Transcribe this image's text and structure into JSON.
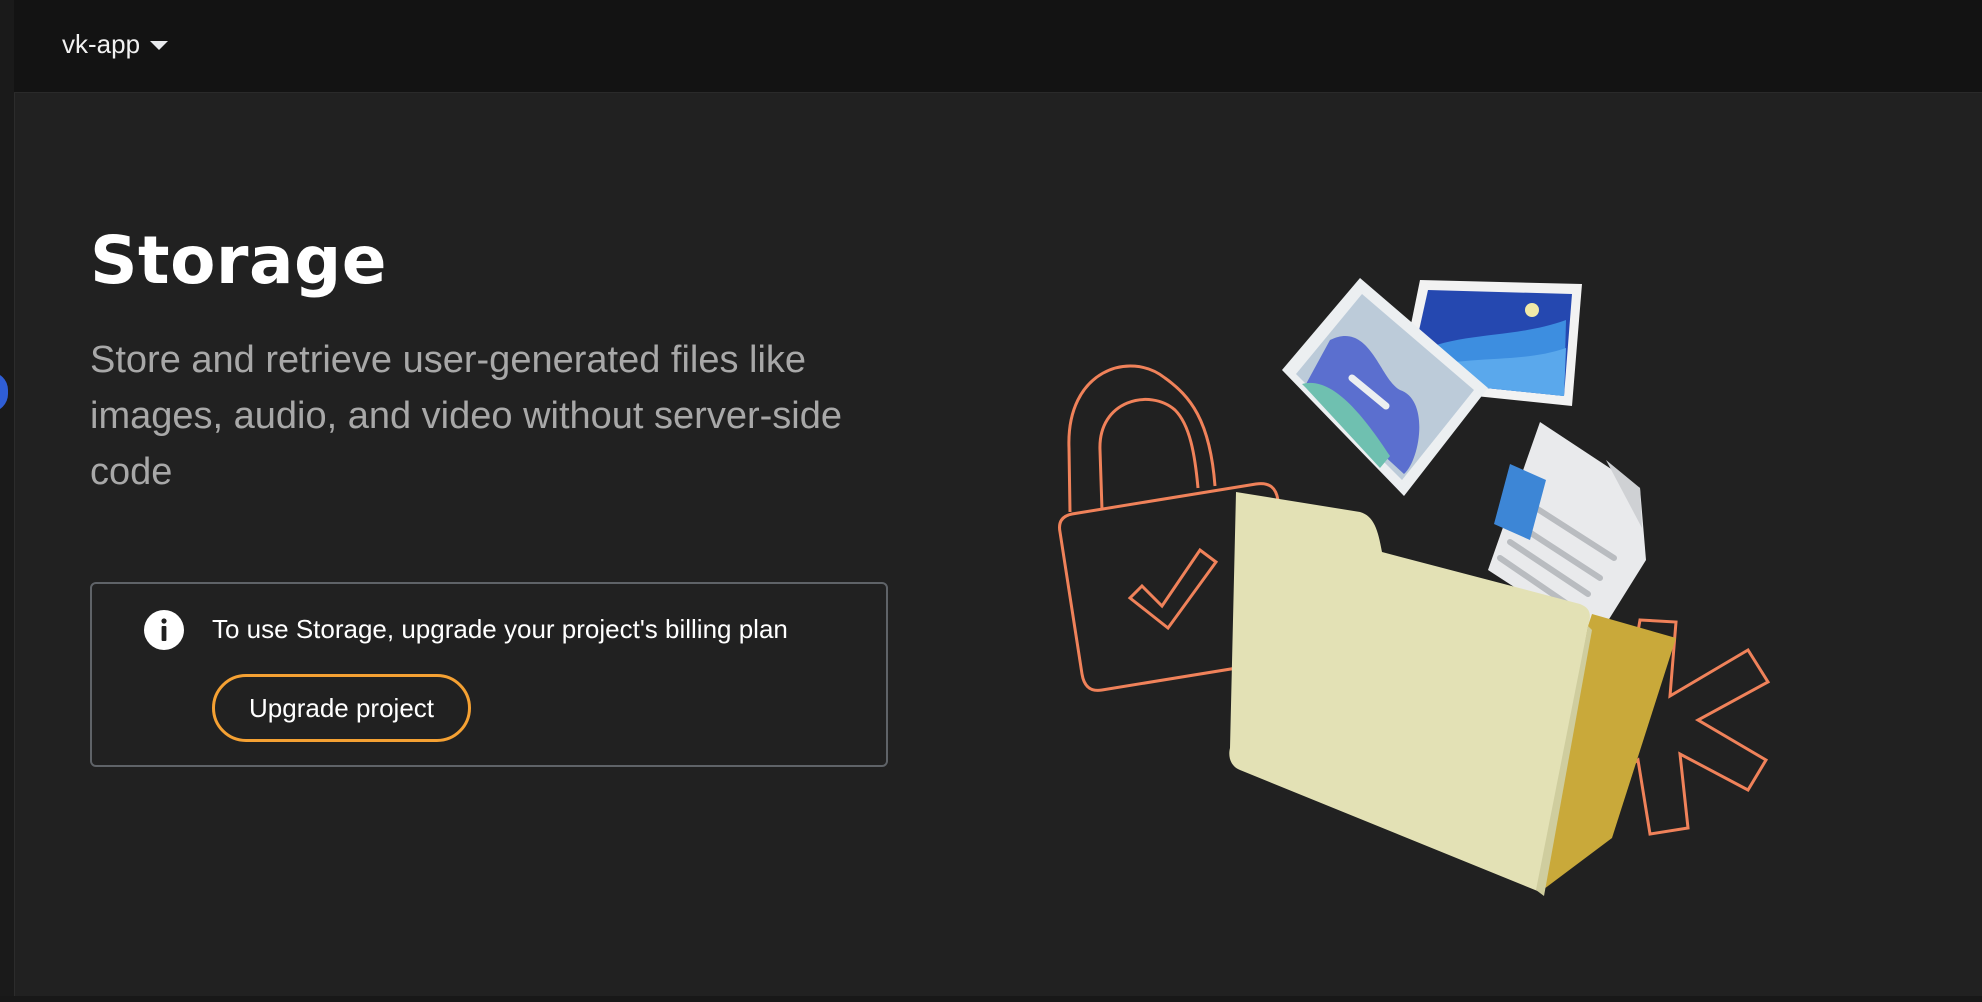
{
  "topbar": {
    "project_name": "vk-app",
    "caret_icon": "caret-down-icon"
  },
  "main": {
    "title": "Storage",
    "description": "Store and retrieve user-generated files like images, audio, and video without server-side code"
  },
  "billing_notice": {
    "icon": "info-icon",
    "message": "To use Storage, upgrade your project's billing plan",
    "button_label": "Upgrade project",
    "accent_color": "#f5a133"
  },
  "illustration": {
    "elements": [
      "padlock-icon",
      "photo-icon",
      "landscape-photo-icon",
      "document-icon",
      "folder-icon",
      "asterisk-icon"
    ],
    "stroke_color": "#f0825a",
    "folder_color": "#e4e2b8"
  }
}
